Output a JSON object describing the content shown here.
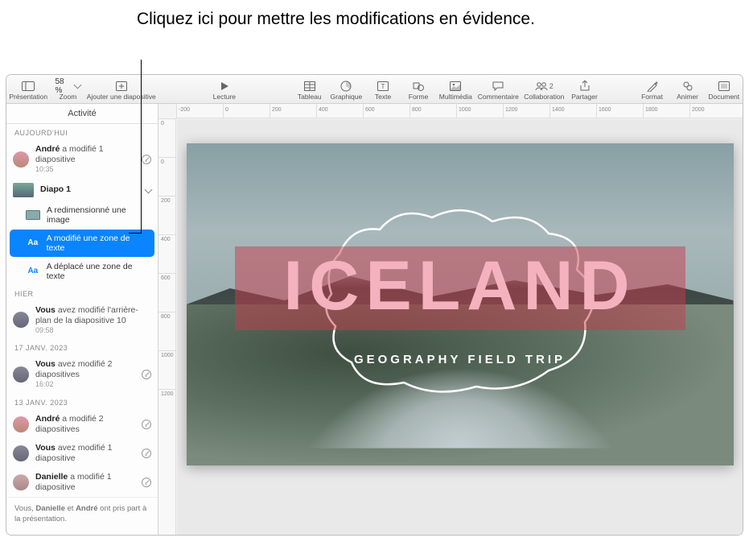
{
  "callout": "Cliquez ici pour mettre les modifications en évidence.",
  "toolbar": {
    "presentation": "Présentation",
    "zoom": "Zoom",
    "zoom_value": "58 %",
    "add_slide": "Ajouter une diapositive",
    "play": "Lecture",
    "table": "Tableau",
    "chart": "Graphique",
    "text": "Texte",
    "shape": "Forme",
    "media": "Multimédia",
    "comment": "Commentaire",
    "collab": "Collaboration",
    "collab_count": "2",
    "share": "Partager",
    "format": "Format",
    "animate": "Animer",
    "document": "Document"
  },
  "sidebar": {
    "tab": "Activité",
    "sections": {
      "today": "AUJOURD'HUI",
      "yesterday": "HIER",
      "date1": "17 JANV. 2023",
      "date2": "13 JANV. 2023"
    },
    "entry_andre": {
      "name": "André",
      "suffix": " a modifié 1 diapositive",
      "time": "10:35"
    },
    "slide_name": "Diapo 1",
    "change_resize": "A redimensionné une image",
    "change_text_mod": "A modifié une zone de texte",
    "change_text_move": "A déplacé une zone de texte",
    "entry_vous_bg": {
      "name": "Vous",
      "suffix": " avez modifié l'arrière-plan de la diapositive 10",
      "time": "09:58"
    },
    "entry_vous_2": {
      "name": "Vous",
      "suffix": " avez modifié 2 diapositives",
      "time": "16:02"
    },
    "entry_andre_2": {
      "name": "André",
      "suffix": " a modifié 2 diapositives"
    },
    "entry_vous_1": {
      "name": "Vous",
      "suffix": " avez modifié 1 diapositive"
    },
    "entry_danielle": {
      "name": "Danielle",
      "suffix": " a modifié 1 diapositive"
    },
    "footer": {
      "prefix": "Vous, ",
      "n1": "Danielle",
      "mid": " et ",
      "n2": "André",
      "suffix": " ont pris part à la présentation."
    }
  },
  "slide": {
    "title": "ICELAND",
    "subtitle": "GEOGRAPHY FIELD TRIP"
  },
  "ruler_h": [
    "-200",
    "0",
    "200",
    "400",
    "600",
    "800",
    "1000",
    "1200",
    "1400",
    "1600",
    "1800",
    "2000"
  ],
  "ruler_v": [
    "0",
    "0",
    "200",
    "400",
    "600",
    "800",
    "1000",
    "1200"
  ]
}
